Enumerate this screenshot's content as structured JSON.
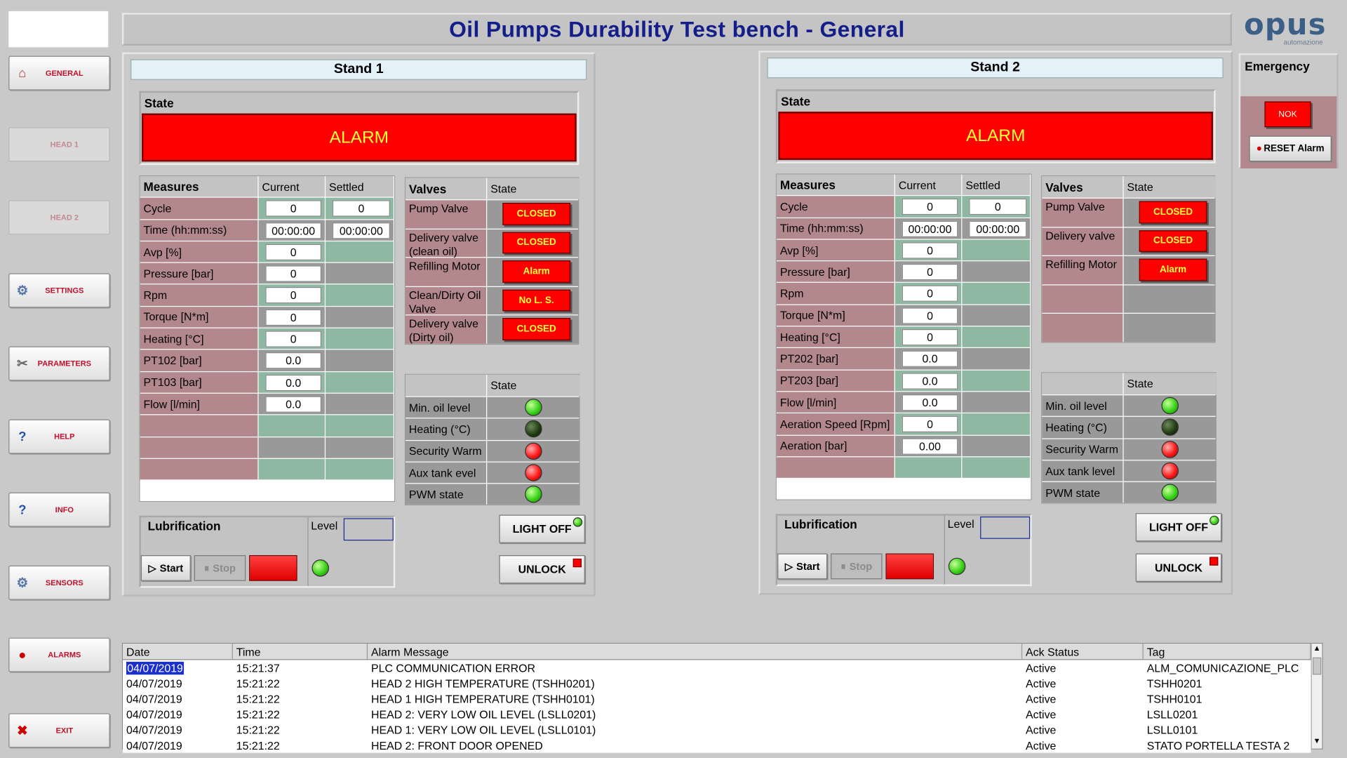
{
  "title": "Oil Pumps Durability Test bench  -  General",
  "brand": {
    "name": "opus",
    "tagline": "automazione"
  },
  "nav": [
    {
      "label": "GENERAL",
      "icon": "home-icon",
      "disabled": false
    },
    {
      "label": "HEAD 1",
      "icon": "",
      "disabled": true
    },
    {
      "label": "HEAD 2",
      "icon": "",
      "disabled": true
    },
    {
      "label": "SETTINGS",
      "icon": "gear-icon",
      "disabled": false
    },
    {
      "label": "PARAMETERS",
      "icon": "tools-icon",
      "disabled": false
    },
    {
      "label": "HELP",
      "icon": "help-icon",
      "disabled": false
    },
    {
      "label": "INFO",
      "icon": "info-icon",
      "disabled": false
    },
    {
      "label": "SENSORS",
      "icon": "gear-icon",
      "disabled": false
    },
    {
      "label": "ALARMS",
      "icon": "alarm-bell-icon",
      "disabled": false
    },
    {
      "label": "EXIT",
      "icon": "exit-icon",
      "disabled": false
    }
  ],
  "emergency": {
    "title": "Emergency",
    "status": "NOK",
    "reset_label": "RESET Alarm"
  },
  "labels": {
    "state": "State",
    "measures": "Measures",
    "current": "Current",
    "settled": "Settled",
    "valves": "Valves",
    "lubrication": "Lubrification",
    "level": "Level",
    "start": "Start",
    "stop": "Stop",
    "light_off": "LIGHT OFF",
    "unlock": "UNLOCK"
  },
  "stand1": {
    "title": "Stand 1",
    "state": "ALARM",
    "measures": [
      {
        "label": "Cycle",
        "current": "0",
        "settled": "0"
      },
      {
        "label": "Time (hh:mm:ss)",
        "current": "00:00:00",
        "settled": "00:00:00"
      },
      {
        "label": "Avp [%]",
        "current": "0",
        "settled": null
      },
      {
        "label": "Pressure [bar]",
        "current": "0",
        "settled": null
      },
      {
        "label": "Rpm",
        "current": "0",
        "settled": null
      },
      {
        "label": "Torque [N*m]",
        "current": "0",
        "settled": null
      },
      {
        "label": "Heating [°C]",
        "current": "0",
        "settled": null
      },
      {
        "label": "PT102 [bar]",
        "current": "0.0",
        "settled": null
      },
      {
        "label": "PT103 [bar]",
        "current": "0.0",
        "settled": null
      },
      {
        "label": "Flow [l/min]",
        "current": "0.0",
        "settled": null
      },
      {
        "label": "",
        "current": null,
        "settled": null
      },
      {
        "label": "",
        "current": null,
        "settled": null
      },
      {
        "label": "",
        "current": null,
        "settled": null
      }
    ],
    "valves": [
      {
        "label": "Pump Valve",
        "state": "CLOSED"
      },
      {
        "label": "Delivery valve (clean oil)",
        "state": "CLOSED"
      },
      {
        "label": "Refilling Motor",
        "state": "Alarm"
      },
      {
        "label": "Clean/Dirty Oil Valve",
        "state": "No L. S."
      },
      {
        "label": "Delivery valve (Dirty oil)",
        "state": "CLOSED"
      }
    ],
    "status": [
      {
        "label": "Min. oil level",
        "led": "green"
      },
      {
        "label": "Heating  (°C)",
        "led": "dark"
      },
      {
        "label": "Security Warm",
        "led": "red"
      },
      {
        "label": "Aux tank evel",
        "led": "red"
      },
      {
        "label": "PWM state",
        "led": "green"
      }
    ]
  },
  "stand2": {
    "title": "Stand 2",
    "state": "ALARM",
    "measures": [
      {
        "label": "Cycle",
        "current": "0",
        "settled": "0"
      },
      {
        "label": "Time (hh:mm:ss)",
        "current": "00:00:00",
        "settled": "00:00:00"
      },
      {
        "label": "Avp [%]",
        "current": "0",
        "settled": null
      },
      {
        "label": "Pressure [bar]",
        "current": "0",
        "settled": null
      },
      {
        "label": "Rpm",
        "current": "0",
        "settled": null
      },
      {
        "label": "Torque [N*m]",
        "current": "0",
        "settled": null
      },
      {
        "label": "Heating [°C]",
        "current": "0",
        "settled": null
      },
      {
        "label": "PT202 [bar]",
        "current": "0.0",
        "settled": null
      },
      {
        "label": "PT203 [bar]",
        "current": "0.0",
        "settled": null
      },
      {
        "label": "Flow [l/min]",
        "current": "0.0",
        "settled": null
      },
      {
        "label": "Aeration Speed [Rpm]",
        "current": "0",
        "settled": null
      },
      {
        "label": "Aeration [bar]",
        "current": "0.00",
        "settled": null
      },
      {
        "label": "",
        "current": null,
        "settled": null
      }
    ],
    "valves": [
      {
        "label": "Pump Valve",
        "state": "CLOSED"
      },
      {
        "label": "Delivery valve",
        "state": "CLOSED"
      },
      {
        "label": "Refilling Motor",
        "state": "Alarm"
      },
      {
        "label": "",
        "state": null
      },
      {
        "label": "",
        "state": null
      }
    ],
    "status": [
      {
        "label": "Min. oil level",
        "led": "green"
      },
      {
        "label": "Heating  (°C)",
        "led": "dark"
      },
      {
        "label": "Security Warm",
        "led": "red"
      },
      {
        "label": "Aux tank level",
        "led": "red"
      },
      {
        "label": "PWM state",
        "led": "green"
      }
    ]
  },
  "alarms": {
    "columns": [
      "Date",
      "Time",
      "Alarm Message",
      "Ack Status",
      "Tag"
    ],
    "rows": [
      [
        "04/07/2019",
        "15:21:37",
        "PLC COMMUNICATION ERROR",
        "Active",
        "ALM_COMUNICAZIONE_PLC"
      ],
      [
        "04/07/2019",
        "15:21:22",
        "HEAD 2 HIGH TEMPERATURE (TSHH0201)",
        "Active",
        "TSHH0201"
      ],
      [
        "04/07/2019",
        "15:21:22",
        "HEAD 1 HIGH TEMPERATURE (TSHH0101)",
        "Active",
        "TSHH0101"
      ],
      [
        "04/07/2019",
        "15:21:22",
        "HEAD 2: VERY LOW OIL LEVEL (LSLL0201)",
        "Active",
        "LSLL0201"
      ],
      [
        "04/07/2019",
        "15:21:22",
        "HEAD 1: VERY LOW OIL LEVEL (LSLL0101)",
        "Active",
        "LSLL0101"
      ],
      [
        "04/07/2019",
        "15:21:22",
        "HEAD 2: FRONT DOOR OPENED",
        "Active",
        "STATO PORTELLA TESTA 2"
      ]
    ]
  }
}
